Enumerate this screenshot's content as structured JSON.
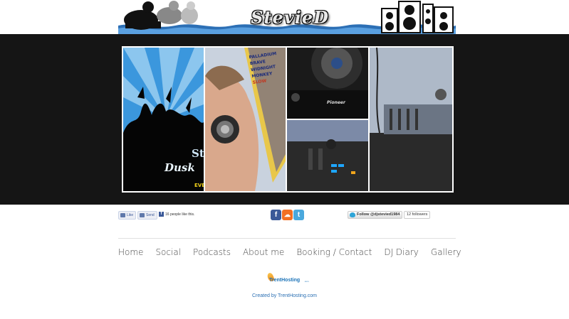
{
  "banner": {
    "logo_text": "StevieD"
  },
  "gallery": {
    "panels": [
      {
        "name": "club-flyer",
        "text_1": "St",
        "text_2": "Dusk",
        "text_3": "EVE"
      },
      {
        "name": "dj-headphones",
        "poster_text": [
          "PALLADIUM",
          "BRAVE",
          "WIDNIGHT",
          "MONKEY",
          "SLOW"
        ]
      },
      {
        "name": "pioneer-cdj",
        "brand": "Pioneer"
      },
      {
        "name": "mixer-desk"
      }
    ]
  },
  "social": {
    "fb_like": "Like",
    "fb_send": "Send",
    "fb_count_text": "16 people like this.",
    "icons": [
      {
        "name": "facebook-icon",
        "glyph": "f",
        "color": "#3b5998"
      },
      {
        "name": "soundcloud-icon",
        "glyph": "☁",
        "color": "#f26f23"
      },
      {
        "name": "twitter-icon",
        "glyph": "t",
        "color": "#4aa8dd"
      }
    ],
    "twitter_follow": "Follow @djstevied1984",
    "twitter_followers": "12 followers"
  },
  "nav": {
    "items": [
      "Home",
      "Social",
      "Podcasts",
      "About me",
      "Booking / Contact",
      "DJ Diary",
      "Gallery"
    ]
  },
  "footer": {
    "logo_name": "TrentHosting",
    "logo_domain": ".com",
    "credit": "Created by TrentHosting.com"
  },
  "colors": {
    "band": "#151515",
    "link": "#2a6fb3",
    "nav_text": "#444444"
  }
}
